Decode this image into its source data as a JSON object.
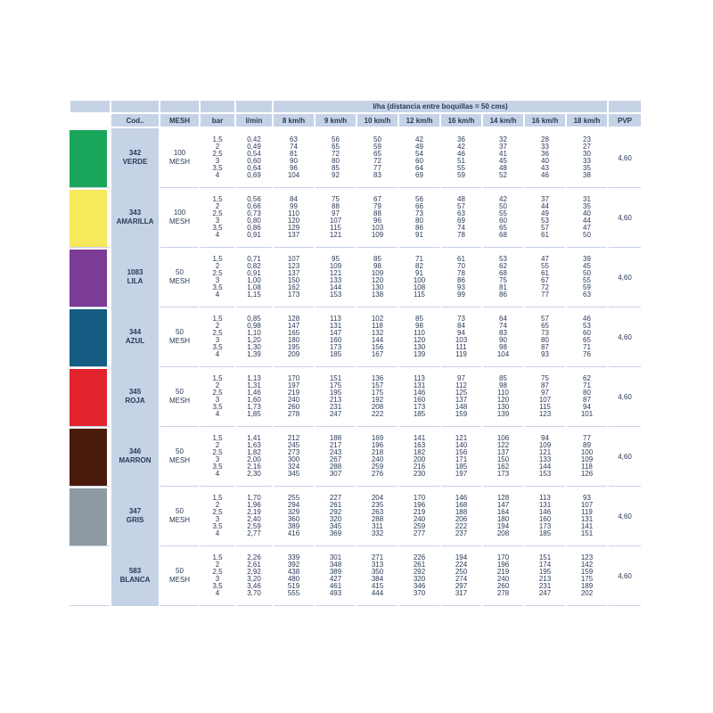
{
  "header": {
    "cod": "Cod..",
    "mesh": "MESH",
    "bar": "bar",
    "lmin": "l/min",
    "lha": "l/ha (distancia entre boquillas = 50 cms)",
    "speeds": [
      "8 km/h",
      "9 km/h",
      "10 km/h",
      "12 km/h",
      "16 km/h",
      "14 km/h",
      "16 km/h",
      "18 km/h"
    ],
    "pvp": "PVP"
  },
  "rows": [
    {
      "code": "342",
      "color_name": "VERDE",
      "color": "#1aa65a",
      "mesh": [
        "100",
        "MESH"
      ],
      "bar": [
        "1,5",
        "2",
        "2,5",
        "3",
        "3,5",
        "4"
      ],
      "lmin": [
        "0,42",
        "0,49",
        "0,54",
        "0,60",
        "0,64",
        "0,69"
      ],
      "cols": [
        [
          "63",
          "74",
          "81",
          "90",
          "96",
          "104"
        ],
        [
          "56",
          "65",
          "72",
          "80",
          "85",
          "92"
        ],
        [
          "50",
          "59",
          "65",
          "72",
          "77",
          "83"
        ],
        [
          "42",
          "49",
          "54",
          "60",
          "64",
          "69"
        ],
        [
          "36",
          "42",
          "46",
          "51",
          "55",
          "59"
        ],
        [
          "32",
          "37",
          "41",
          "45",
          "48",
          "52"
        ],
        [
          "28",
          "33",
          "36",
          "40",
          "43",
          "46"
        ],
        [
          "23",
          "27",
          "30",
          "33",
          "35",
          "38"
        ]
      ],
      "pvp": "4,60"
    },
    {
      "code": "343",
      "color_name": "AMARILLA",
      "color": "#f6e95b",
      "mesh": [
        "100",
        "MESH"
      ],
      "bar": [
        "1,5",
        "2",
        "2,5",
        "3",
        "3,5",
        "4"
      ],
      "lmin": [
        "0,56",
        "0,66",
        "0,73",
        "0,80",
        "0,86",
        "0,91"
      ],
      "cols": [
        [
          "84",
          "99",
          "110",
          "120",
          "129",
          "137"
        ],
        [
          "75",
          "88",
          "97",
          "107",
          "115",
          "121"
        ],
        [
          "67",
          "79",
          "88",
          "96",
          "103",
          "109"
        ],
        [
          "56",
          "66",
          "73",
          "80",
          "86",
          "91"
        ],
        [
          "48",
          "57",
          "63",
          "69",
          "74",
          "78"
        ],
        [
          "42",
          "50",
          "55",
          "60",
          "65",
          "68"
        ],
        [
          "37",
          "44",
          "49",
          "53",
          "57",
          "61"
        ],
        [
          "31",
          "35",
          "40",
          "44",
          "47",
          "50"
        ]
      ],
      "pvp": "4,60"
    },
    {
      "code": "1083",
      "color_name": "LILA",
      "color": "#7b3c96",
      "mesh": [
        "50",
        "MESH"
      ],
      "bar": [
        "1,5",
        "2",
        "2,5",
        "3",
        "3,5",
        "4"
      ],
      "lmin": [
        "0,71",
        "0,82",
        "0,91",
        "1,00",
        "1,08",
        "1,15"
      ],
      "cols": [
        [
          "107",
          "123",
          "137",
          "150",
          "162",
          "173"
        ],
        [
          "95",
          "109",
          "121",
          "133",
          "144",
          "153"
        ],
        [
          "85",
          "98",
          "109",
          "120",
          "130",
          "138"
        ],
        [
          "71",
          "82",
          "91",
          "100",
          "108",
          "115"
        ],
        [
          "61",
          "70",
          "78",
          "86",
          "93",
          "99"
        ],
        [
          "53",
          "62",
          "68",
          "75",
          "81",
          "86"
        ],
        [
          "47",
          "55",
          "61",
          "67",
          "72",
          "77"
        ],
        [
          "39",
          "45",
          "50",
          "55",
          "59",
          "63"
        ]
      ],
      "pvp": "4,60"
    },
    {
      "code": "344",
      "color_name": "AZUL",
      "color": "#145c82",
      "mesh": [
        "50",
        "MESH"
      ],
      "bar": [
        "1,5",
        "2",
        "2,5",
        "3",
        "3,5",
        "4"
      ],
      "lmin": [
        "0,85",
        "0,98",
        "1,10",
        "1,20",
        "1,30",
        "1,39"
      ],
      "cols": [
        [
          "128",
          "147",
          "165",
          "180",
          "195",
          "209"
        ],
        [
          "113",
          "131",
          "147",
          "160",
          "173",
          "185"
        ],
        [
          "102",
          "118",
          "132",
          "144",
          "156",
          "167"
        ],
        [
          "85",
          "98",
          "110",
          "120",
          "130",
          "139"
        ],
        [
          "73",
          "84",
          "94",
          "103",
          "111",
          "119"
        ],
        [
          "64",
          "74",
          "83",
          "90",
          "98",
          "104"
        ],
        [
          "57",
          "65",
          "73",
          "80",
          "87",
          "93"
        ],
        [
          "46",
          "53",
          "60",
          "65",
          "71",
          "76"
        ]
      ],
      "pvp": "4,60"
    },
    {
      "code": "345",
      "color_name": "ROJA",
      "color": "#e2232e",
      "mesh": [
        "50",
        "MESH"
      ],
      "bar": [
        "1,5",
        "2",
        "2,5",
        "3",
        "3,5",
        "4"
      ],
      "lmin": [
        "1,13",
        "1,31",
        "1,46",
        "1,60",
        "1,73",
        "1,85"
      ],
      "cols": [
        [
          "170",
          "197",
          "219",
          "240",
          "260",
          "278"
        ],
        [
          "151",
          "175",
          "195",
          "213",
          "231",
          "247"
        ],
        [
          "136",
          "157",
          "175",
          "192",
          "208",
          "222"
        ],
        [
          "113",
          "131",
          "146",
          "160",
          "173",
          "185"
        ],
        [
          "97",
          "112",
          "125",
          "137",
          "148",
          "159"
        ],
        [
          "85",
          "98",
          "110",
          "120",
          "130",
          "139"
        ],
        [
          "75",
          "87",
          "97",
          "107",
          "115",
          "123"
        ],
        [
          "62",
          "71",
          "80",
          "87",
          "94",
          "101"
        ]
      ],
      "pvp": "4,60"
    },
    {
      "code": "346",
      "color_name": "MARRON",
      "color": "#4a1a0c",
      "mesh": [
        "50",
        "MESH"
      ],
      "bar": [
        "1,5",
        "2",
        "2,5",
        "3",
        "3,5",
        "4"
      ],
      "lmin": [
        "1,41",
        "1,63",
        "1,82",
        "2,00",
        "2,16",
        "2,30"
      ],
      "cols": [
        [
          "212",
          "245",
          "273",
          "300",
          "324",
          "345"
        ],
        [
          "188",
          "217",
          "243",
          "267",
          "288",
          "307"
        ],
        [
          "169",
          "196",
          "218",
          "240",
          "259",
          "276"
        ],
        [
          "141",
          "163",
          "182",
          "200",
          "216",
          "230"
        ],
        [
          "121",
          "140",
          "156",
          "171",
          "185",
          "197"
        ],
        [
          "106",
          "122",
          "137",
          "150",
          "162",
          "173"
        ],
        [
          "94",
          "109",
          "121",
          "133",
          "144",
          "153"
        ],
        [
          "77",
          "89",
          "100",
          "109",
          "118",
          "126"
        ]
      ],
      "pvp": "4,60"
    },
    {
      "code": "347",
      "color_name": "GRIS",
      "color": "#8d9aa1",
      "mesh": [
        "50",
        "MESH"
      ],
      "bar": [
        "1,5",
        "2",
        "2,5",
        "3",
        "3,5",
        "4"
      ],
      "lmin": [
        "1,70",
        "1,96",
        "2,19",
        "2,40",
        "2,59",
        "2,77"
      ],
      "cols": [
        [
          "255",
          "294",
          "329",
          "360",
          "389",
          "416"
        ],
        [
          "227",
          "261",
          "292",
          "320",
          "345",
          "369"
        ],
        [
          "204",
          "235",
          "263",
          "288",
          "311",
          "332"
        ],
        [
          "170",
          "196",
          "219",
          "240",
          "259",
          "277"
        ],
        [
          "146",
          "168",
          "188",
          "206",
          "222",
          "237"
        ],
        [
          "128",
          "147",
          "164",
          "180",
          "194",
          "208"
        ],
        [
          "113",
          "131",
          "146",
          "160",
          "173",
          "185"
        ],
        [
          "93",
          "107",
          "119",
          "131",
          "141",
          "151"
        ]
      ],
      "pvp": "4,60"
    },
    {
      "code": "583",
      "color_name": "BLANCA",
      "color": "#ffffff",
      "mesh": [
        "50",
        "MESH"
      ],
      "bar": [
        "1,5",
        "2",
        "2,5",
        "3",
        "3,5",
        "4"
      ],
      "lmin": [
        "2,26",
        "2,61",
        "2,92",
        "3,20",
        "3,46",
        "3,70"
      ],
      "cols": [
        [
          "339",
          "392",
          "438",
          "480",
          "519",
          "555"
        ],
        [
          "301",
          "348",
          "389",
          "427",
          "461",
          "493"
        ],
        [
          "271",
          "313",
          "350",
          "384",
          "415",
          "444"
        ],
        [
          "226",
          "261",
          "292",
          "320",
          "346",
          "370"
        ],
        [
          "194",
          "224",
          "250",
          "274",
          "297",
          "317"
        ],
        [
          "170",
          "196",
          "219",
          "240",
          "260",
          "278"
        ],
        [
          "151",
          "174",
          "195",
          "213",
          "231",
          "247"
        ],
        [
          "123",
          "142",
          "159",
          "175",
          "189",
          "202"
        ]
      ],
      "pvp": "4,60"
    }
  ]
}
